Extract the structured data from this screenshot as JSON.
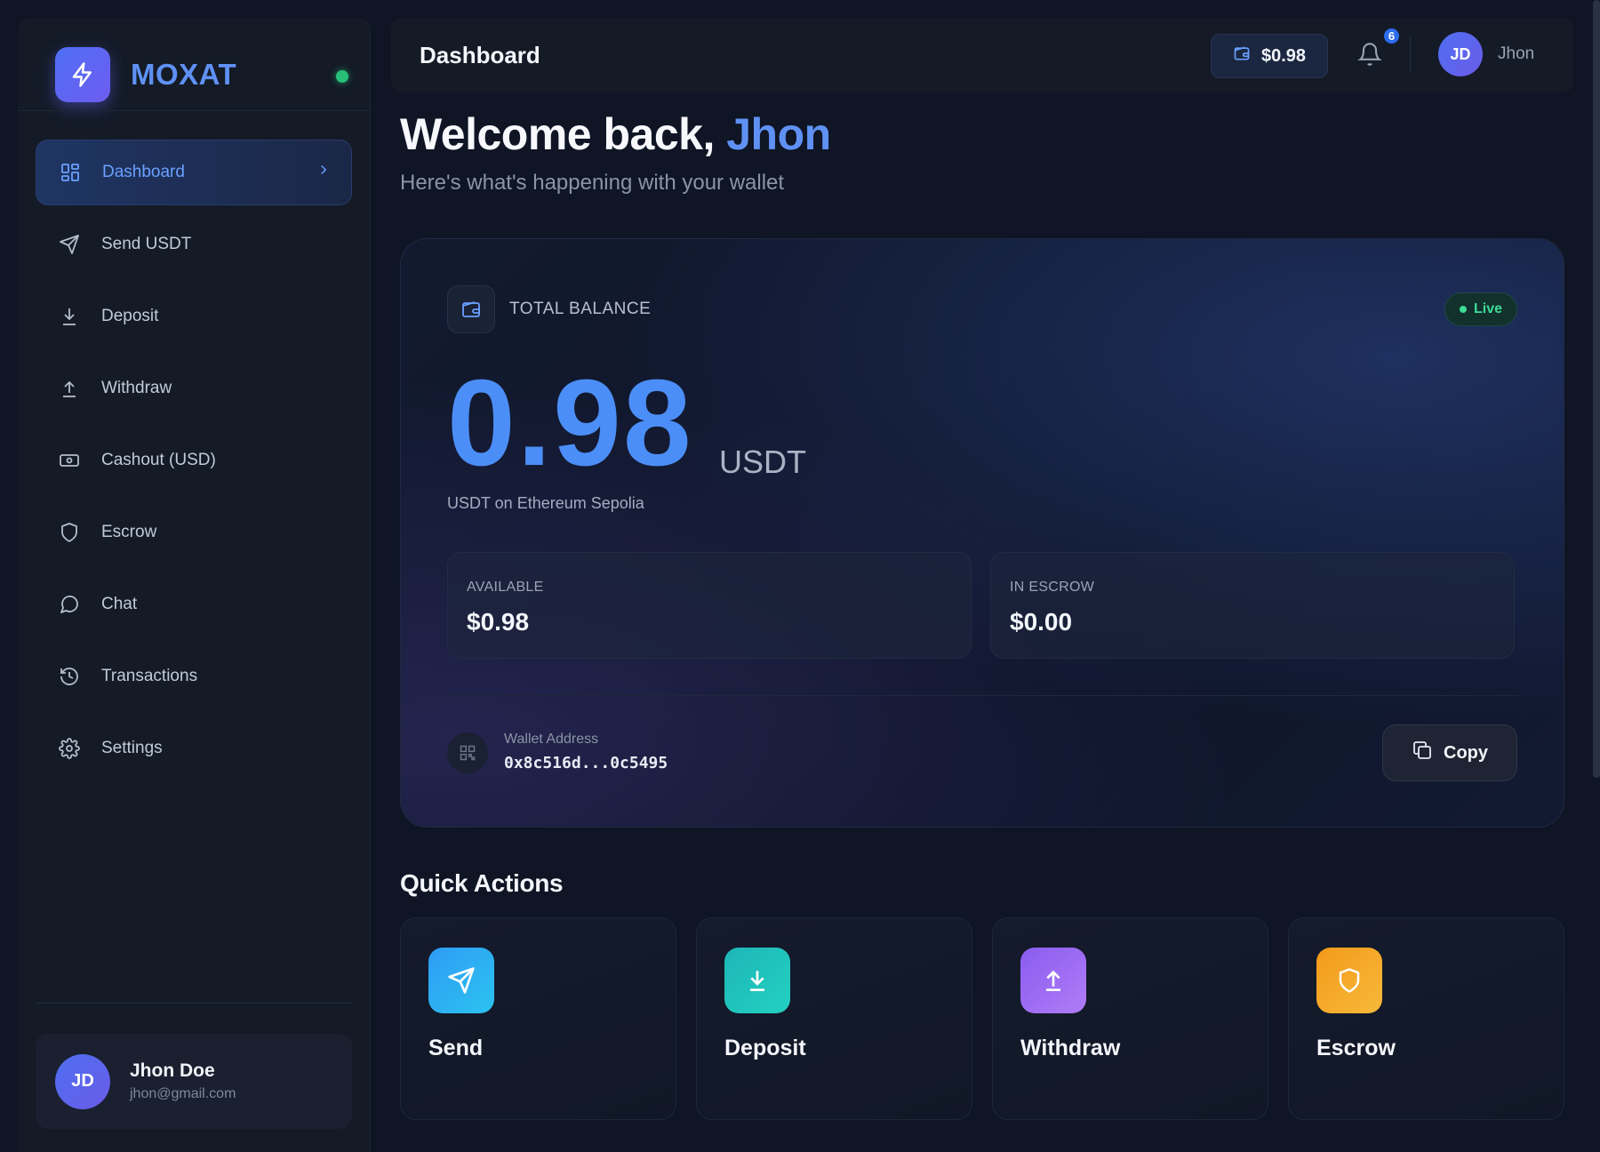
{
  "brand": {
    "name": "MOXAT",
    "logo_icon": "bolt-icon",
    "status_color": "#28c076"
  },
  "sidebar": {
    "items": [
      {
        "label": "Dashboard",
        "icon": "grid-icon",
        "active": true
      },
      {
        "label": "Send USDT",
        "icon": "send-icon",
        "active": false
      },
      {
        "label": "Deposit",
        "icon": "download-icon",
        "active": false
      },
      {
        "label": "Withdraw",
        "icon": "upload-icon",
        "active": false
      },
      {
        "label": "Cashout (USD)",
        "icon": "banknote-icon",
        "active": false
      },
      {
        "label": "Escrow",
        "icon": "shield-icon",
        "active": false
      },
      {
        "label": "Chat",
        "icon": "chat-icon",
        "active": false
      },
      {
        "label": "Transactions",
        "icon": "history-icon",
        "active": false
      },
      {
        "label": "Settings",
        "icon": "gear-icon",
        "active": false
      }
    ],
    "user": {
      "initials": "JD",
      "name": "Jhon Doe",
      "email": "jhon@gmail.com"
    }
  },
  "header": {
    "title": "Dashboard",
    "balance": "$0.98",
    "notifications_count": "6",
    "user_initials": "JD",
    "user_name": "Jhon"
  },
  "welcome": {
    "prefix": "Welcome back, ",
    "name": "Jhon",
    "subtitle": "Here's what's happening with your wallet"
  },
  "balance_card": {
    "label": "TOTAL BALANCE",
    "live_label": "Live",
    "amount": "0.98",
    "unit": "USDT",
    "network": "USDT on Ethereum Sepolia",
    "available_label": "AVAILABLE",
    "available_value": "$0.98",
    "escrow_label": "IN ESCROW",
    "escrow_value": "$0.00",
    "wallet_label": "Wallet Address",
    "wallet_value": "0x8c516d...0c5495",
    "copy_label": "Copy"
  },
  "quick_actions": {
    "title": "Quick Actions",
    "items": [
      {
        "label": "Send",
        "icon": "send-icon",
        "color_from": "#2f9bf5",
        "color_to": "#2bc3f0"
      },
      {
        "label": "Deposit",
        "icon": "download-icon",
        "color_from": "#1eb5b8",
        "color_to": "#23d1c1"
      },
      {
        "label": "Withdraw",
        "icon": "upload-icon",
        "color_from": "#8b5cf0",
        "color_to": "#b07cf6"
      },
      {
        "label": "Escrow",
        "icon": "shield-icon",
        "color_from": "#f39a1a",
        "color_to": "#f7b93a"
      }
    ]
  },
  "colors": {
    "accent": "#5f91f4",
    "balance": "#4c8ef7",
    "live": "#3ddc97",
    "badge": "#2d6cf0"
  }
}
